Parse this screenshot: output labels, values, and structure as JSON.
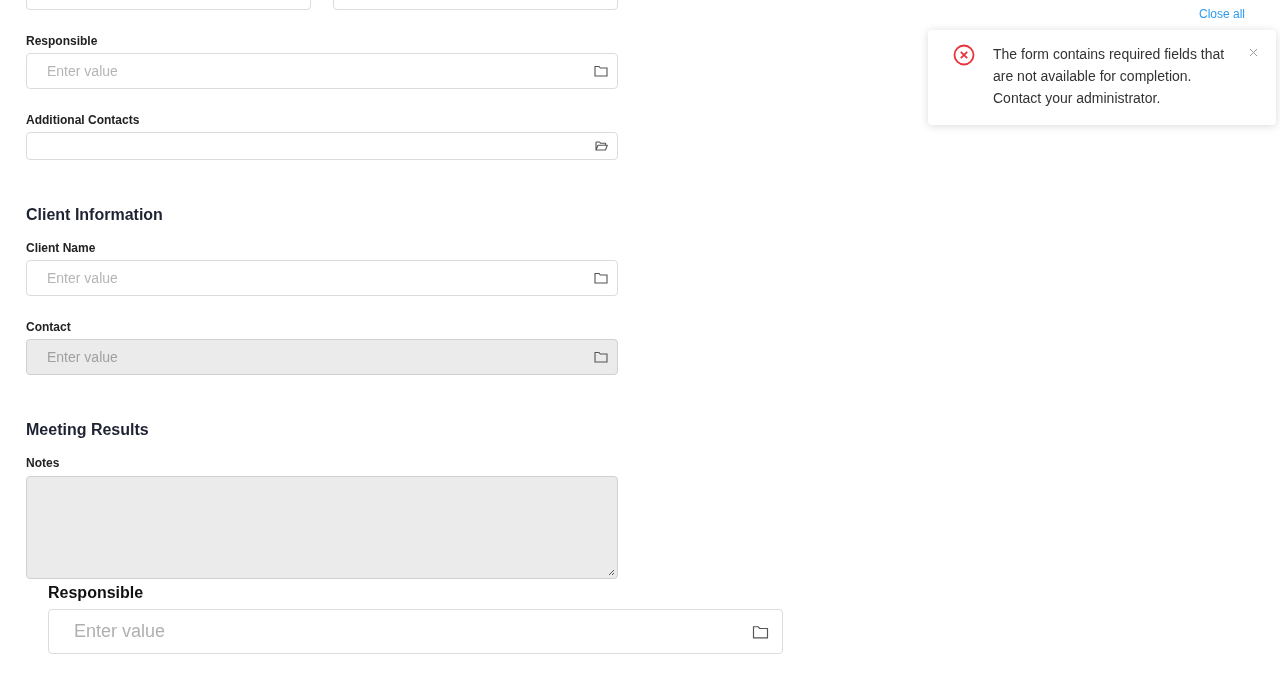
{
  "fields_upper": [
    {
      "label": "Responsible",
      "placeholder": "Enter value",
      "kind": "lookup",
      "disabled": false
    },
    {
      "label": "Additional Contacts",
      "kind": "multi_lookup",
      "disabled": false
    }
  ],
  "sections": [
    {
      "title": "Client Information",
      "fields": [
        {
          "label": "Client Name",
          "placeholder": "Enter value",
          "kind": "lookup",
          "disabled": false
        },
        {
          "label": "Contact",
          "placeholder": "Enter value",
          "kind": "lookup",
          "disabled": true
        }
      ]
    },
    {
      "title": "Meeting Results",
      "fields": [
        {
          "label": "Notes",
          "kind": "textarea",
          "disabled": true
        }
      ]
    }
  ],
  "dragged_field": {
    "label": "Responsible",
    "placeholder": "Enter value",
    "kind": "lookup",
    "disabled": false
  },
  "notifications": {
    "close_all": "Close all",
    "items": [
      {
        "kind": "error",
        "message": "The form contains required fields that are not available for completion. Contact your administrator."
      }
    ]
  }
}
